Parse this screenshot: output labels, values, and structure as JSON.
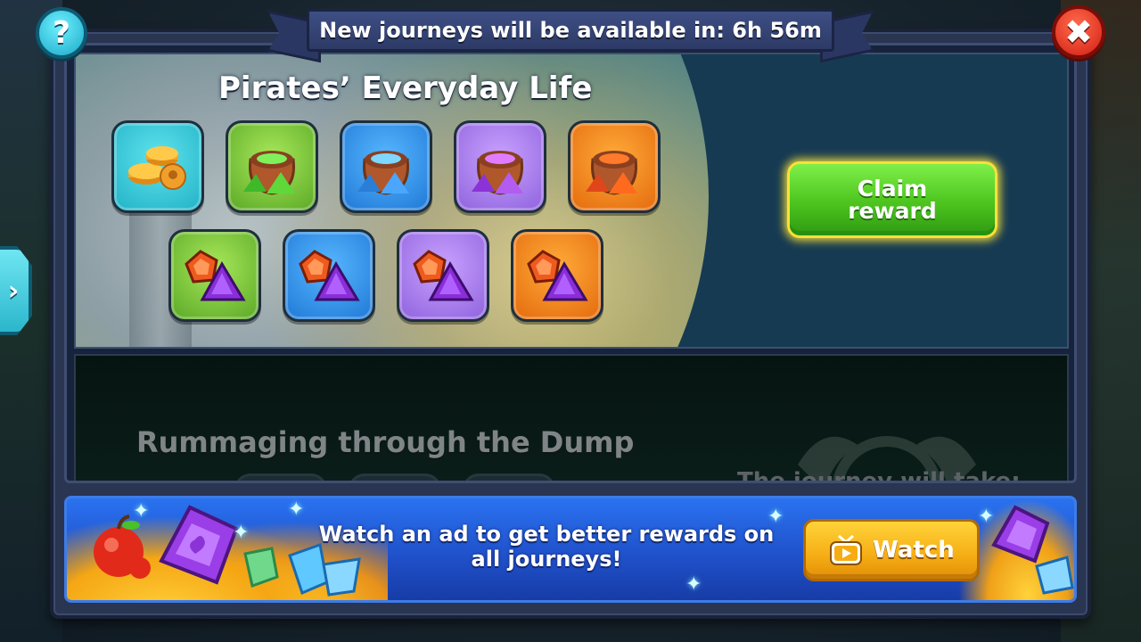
{
  "header": {
    "timer_text": "New journeys will be available in: 6h 56m",
    "help_label": "?",
    "close_label": "✖"
  },
  "side_tab": {
    "label": "›"
  },
  "journeys": [
    {
      "title": "Pirates’ Everyday Life",
      "claim_label": "Claim reward",
      "rewards_row1": [
        {
          "icon": "coins-icon",
          "color": "teal"
        },
        {
          "icon": "green-potion-bag-icon",
          "color": "green"
        },
        {
          "icon": "blue-potion-bag-icon",
          "color": "blue"
        },
        {
          "icon": "purple-potion-bag-icon",
          "color": "purple"
        },
        {
          "icon": "orange-potion-bag-icon",
          "color": "orange"
        }
      ],
      "rewards_row2": [
        {
          "icon": "green-gems-icon",
          "color": "green"
        },
        {
          "icon": "blue-gems-icon",
          "color": "blue"
        },
        {
          "icon": "purple-gems-icon",
          "color": "purple"
        },
        {
          "icon": "orange-gems-icon",
          "color": "orange"
        }
      ]
    },
    {
      "title": "Rummaging through the Dump",
      "hint": "The journey will take:"
    }
  ],
  "ad": {
    "text": "Watch an ad to get better rewards on all journeys!",
    "watch_label": "Watch"
  },
  "colors": {
    "claim_green": "#4cc41e",
    "watch_gold": "#f6ad14",
    "close_red": "#d31e12",
    "help_cyan": "#1aa9c8"
  }
}
